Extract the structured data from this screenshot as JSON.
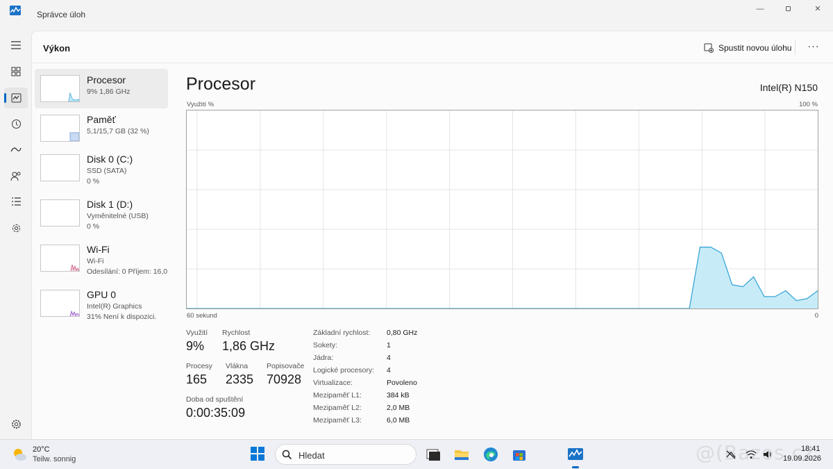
{
  "window": {
    "title": "Správce úloh",
    "icon": "task-manager-icon",
    "controls": [
      "minimize-icon",
      "restore-icon",
      "close-icon"
    ]
  },
  "nav_rail": {
    "items": [
      {
        "icon": "hamburger-menu-icon"
      },
      {
        "icon": "processes-icon"
      },
      {
        "icon": "performance-icon",
        "active": true
      },
      {
        "icon": "app-history-icon"
      },
      {
        "icon": "startup-apps-icon"
      },
      {
        "icon": "users-icon"
      },
      {
        "icon": "details-icon"
      },
      {
        "icon": "services-icon"
      }
    ],
    "settings_icon": "gear-icon"
  },
  "header": {
    "title": "Výkon",
    "run_task_label": "Spustit novou úlohu",
    "more_label": "···"
  },
  "perf_list": [
    {
      "name": "Procesor",
      "sub1": "9%  1,86 GHz",
      "sub2": "",
      "selected": true
    },
    {
      "name": "Paměť",
      "sub1": "5,1/15,7 GB (32 %)",
      "sub2": ""
    },
    {
      "name": "Disk 0 (C:)",
      "sub1": "SSD (SATA)",
      "sub2": "0 %"
    },
    {
      "name": "Disk 1 (D:)",
      "sub1": "Vyměnitelné (USB)",
      "sub2": "0 %"
    },
    {
      "name": "Wi-Fi",
      "sub1": "Wi-Fi",
      "sub2": "Odesílání: 0  Příjem: 16,0"
    },
    {
      "name": "GPU 0",
      "sub1": "Intel(R) Graphics",
      "sub2": "31%  Není k dispozici."
    }
  ],
  "detail": {
    "title": "Procesor",
    "model": "Intel(R) N150",
    "graph": {
      "y_label": "Využití %",
      "y_max_label": "100 %",
      "x_left_label": "60 sekund",
      "x_right_label": "0",
      "fill_color": "#c7ecf8",
      "line_color": "#3aa5d8"
    },
    "stats": {
      "utilization_label": "Využití",
      "utilization_value": "9%",
      "speed_label": "Rychlost",
      "speed_value": "1,86 GHz",
      "processes_label": "Procesy",
      "processes_value": "165",
      "threads_label": "Vlákna",
      "threads_value": "2335",
      "handles_label": "Popisovače",
      "handles_value": "70928",
      "uptime_label": "Doba od spuštění",
      "uptime_value": "0:00:35:09"
    },
    "specs": [
      {
        "key": "Základní rychlost:",
        "value": "0,80 GHz"
      },
      {
        "key": "Sokety:",
        "value": "1"
      },
      {
        "key": "Jádra:",
        "value": "4"
      },
      {
        "key": "Logické procesory:",
        "value": "4"
      },
      {
        "key": "Virtualizace:",
        "value": "Povoleno"
      },
      {
        "key": "Mezipaměť L1:",
        "value": "384 kB"
      },
      {
        "key": "Mezipaměť L2:",
        "value": "2,0 MB"
      },
      {
        "key": "Mezipaměť L3:",
        "value": "6,0 MB"
      }
    ]
  },
  "chart_data": {
    "type": "area",
    "y_unit": "%",
    "ylim": [
      0,
      100
    ],
    "x_range_seconds": 60,
    "values": [
      0,
      0,
      0,
      0,
      0,
      0,
      0,
      0,
      0,
      0,
      0,
      0,
      0,
      0,
      0,
      0,
      0,
      0,
      0,
      0,
      0,
      0,
      0,
      0,
      0,
      0,
      0,
      0,
      0,
      0,
      0,
      0,
      0,
      0,
      0,
      0,
      0,
      0,
      0,
      0,
      0,
      0,
      0,
      0,
      0,
      0,
      0,
      0,
      31,
      31,
      28,
      12,
      11,
      16,
      6,
      6,
      9,
      4,
      5,
      9
    ]
  },
  "taskbar": {
    "weather_temp": "20°C",
    "weather_desc": "Teilw. sonnig",
    "search_placeholder": "Hledat",
    "time": "18:41",
    "date": "19.09.2026",
    "watermark": "@(Bazos.cz",
    "pinned_icons": [
      "start-icon",
      "search-icon",
      "terminal-icon",
      "file-explorer-icon",
      "edge-icon",
      "store-icon",
      "task-manager-icon"
    ],
    "tray_icons": [
      "network-off-icon",
      "wifi-icon",
      "volume-icon"
    ]
  }
}
